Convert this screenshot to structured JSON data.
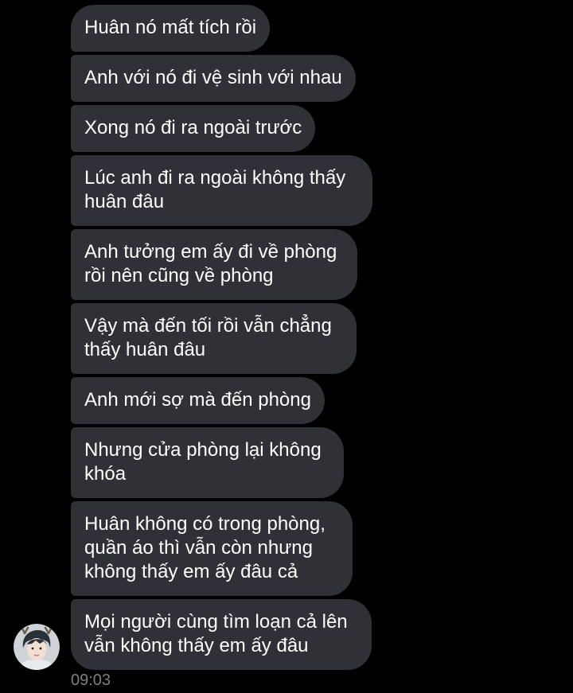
{
  "messages": [
    "Huân nó mất tích rồi",
    "Anh với nó đi vệ sinh với nhau",
    "Xong nó đi ra ngoài trước",
    "Lúc anh đi ra ngoài không thấy huân đâu",
    "Anh tưởng em ấy đi về phòng rồi nên cũng về phòng",
    "Vậy mà đến tối rồi vẫn chẳng thấy huân đâu",
    "Anh mới sợ mà đến phòng",
    "Nhưng cửa phòng lại không khóa",
    "Huân không có trong phòng, quần áo thì vẫn còn nhưng không thấy em ấy đâu cả",
    "Mọi người cùng tìm loạn cả lên vẫn không thấy em ấy đâu"
  ],
  "timestamp": "09:03",
  "colors": {
    "background": "#000000",
    "bubble": "#2f3136",
    "text": "#ffffff",
    "timestamp": "#7c7f86"
  },
  "sender": {
    "avatar_icon": "avatar-photo"
  }
}
